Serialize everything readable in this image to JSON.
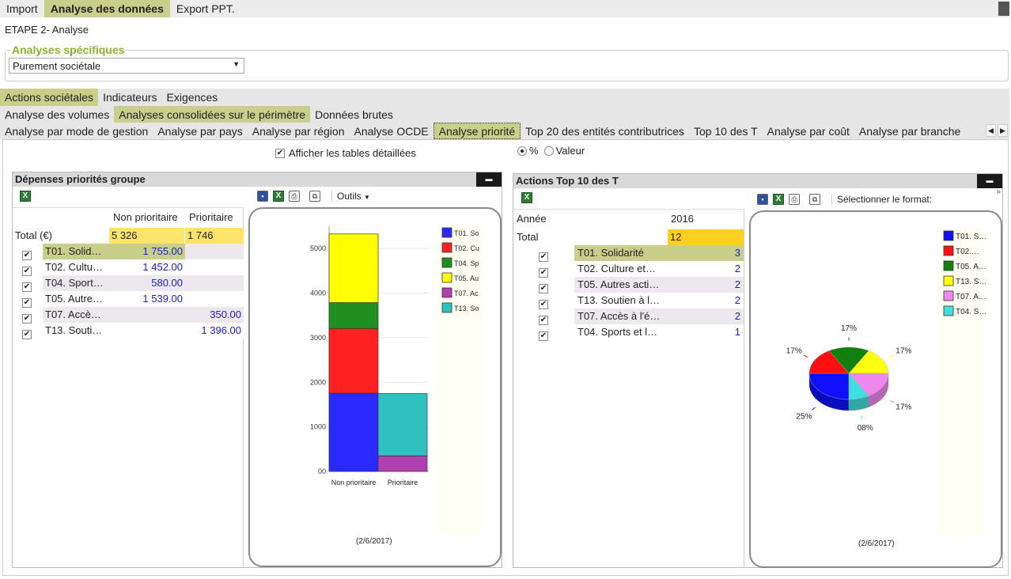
{
  "top_tabs": [
    "Import",
    "Analyse des données",
    "Export PPT."
  ],
  "step": "ETAPE 2- Analyse",
  "group_legend": "Analyses spécifiques",
  "select_value": "Purement sociétale",
  "tabs2": [
    "Actions sociétales",
    "Indicateurs",
    "Exigences"
  ],
  "tabs3": [
    "Analyse des volumes",
    "Analyses consolidées sur le périmètre",
    "Données brutes"
  ],
  "tabs4": [
    "Analyse par mode de gestion",
    "Analyse par pays",
    "Analyse par région",
    "Analyse OCDE",
    "Analyse priorité",
    "Top 20 des entités contributrices",
    "Top 10 des T",
    "Analyse par coût",
    "Analyse par branche"
  ],
  "show_tables_label": "Afficher les tables détaillées",
  "radio_pct": "%",
  "radio_val": "Valeur",
  "left": {
    "title": "Dépenses priorités groupe",
    "col1": "Non prioritaire",
    "col2": "Prioritaire",
    "total_label": "Total (€)",
    "total1": "5 326",
    "total2": "1 746",
    "rows": [
      {
        "label": "T01. Solid…",
        "v1": "1 755.00",
        "v2": ""
      },
      {
        "label": "T02.  Cultu…",
        "v1": "1 452.00",
        "v2": ""
      },
      {
        "label": "T04.  Sport…",
        "v1": "580.00",
        "v2": ""
      },
      {
        "label": "T05.  Autre…",
        "v1": "1 539.00",
        "v2": ""
      },
      {
        "label": "T07.  Accè…",
        "v1": "",
        "v2": "350.00"
      },
      {
        "label": "T13.  Souti…",
        "v1": "",
        "v2": "1 396.00"
      }
    ],
    "outils": "Outils",
    "date": "(2/6/2017)"
  },
  "right": {
    "title": "Actions Top 10 des T",
    "col_annee": "Année",
    "year": "2016",
    "total_label": "Total",
    "total": "12",
    "rows": [
      {
        "label": "T01. Solidarité",
        "v": "3"
      },
      {
        "label": "T02.  Culture  et…",
        "v": "2"
      },
      {
        "label": "T05.  Autres  acti…",
        "v": "2"
      },
      {
        "label": "T13.  Soutien  à  l…",
        "v": "2"
      },
      {
        "label": "T07.  Accès  à  l'é…",
        "v": "2"
      },
      {
        "label": "T04.  Sports  et  l…",
        "v": "1"
      }
    ],
    "format_label": "Sélectionner le format:",
    "date": "(2/6/2017)"
  },
  "chart_data": [
    {
      "type": "bar",
      "stacked": true,
      "categories": [
        "Non prioritaire",
        "Prioritaire"
      ],
      "ylim": [
        0,
        5500
      ],
      "yticks": [
        "00",
        "1000",
        "2000",
        "3000",
        "4000",
        "5000"
      ],
      "series": [
        {
          "name": "T01. So",
          "color": "#2a2aff",
          "values": [
            1755,
            0
          ]
        },
        {
          "name": "T02. Cu",
          "color": "#ff2020",
          "values": [
            1452,
            0
          ]
        },
        {
          "name": "T04. Sp",
          "color": "#1f8f1f",
          "values": [
            580,
            0
          ]
        },
        {
          "name": "T05. Au",
          "color": "#ffff00",
          "values": [
            1539,
            0
          ]
        },
        {
          "name": "T07. Ac",
          "color": "#b040b0",
          "values": [
            0,
            350
          ]
        },
        {
          "name": "T13. So",
          "color": "#30c0c0",
          "values": [
            0,
            1396
          ]
        }
      ]
    },
    {
      "type": "pie",
      "labels": [
        "T01. S…",
        "T02.…",
        "T05. A…",
        "T13. S…",
        "T07. A…",
        "T04. S…"
      ],
      "values": [
        3,
        2,
        2,
        2,
        2,
        1
      ],
      "percent_labels": [
        "25%",
        "17%",
        "17%",
        "17%",
        "17%",
        "08%"
      ],
      "colors": [
        "#1010ff",
        "#ff1010",
        "#108010",
        "#ffff10",
        "#ee88ee",
        "#40e0e0"
      ]
    }
  ]
}
